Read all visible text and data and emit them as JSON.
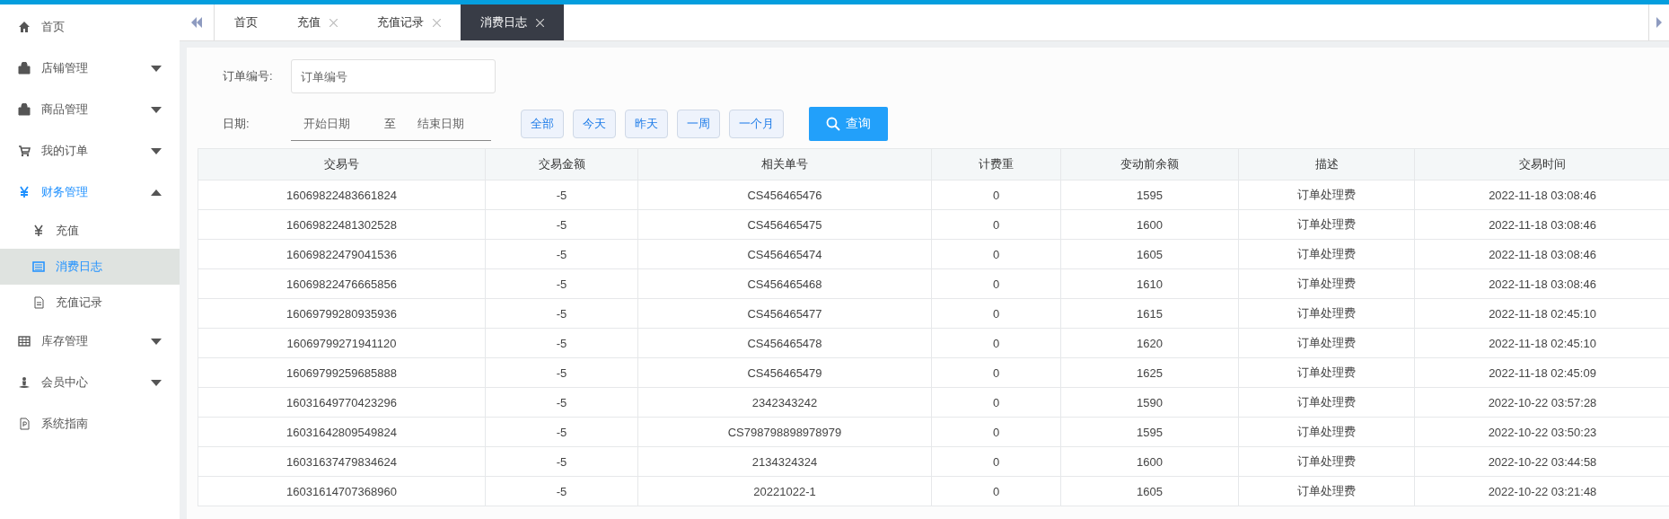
{
  "sidebar": {
    "items": [
      {
        "label": "首页",
        "kind": "link",
        "selected": false
      },
      {
        "label": "店铺管理",
        "kind": "group",
        "selected": false,
        "expanded": false
      },
      {
        "label": "商品管理",
        "kind": "group",
        "selected": false,
        "expanded": false
      },
      {
        "label": "我的订单",
        "kind": "group",
        "selected": false,
        "expanded": false
      },
      {
        "label": "财务管理",
        "kind": "group",
        "selected": true,
        "expanded": true,
        "children": [
          {
            "label": "充值",
            "selected": false
          },
          {
            "label": "消费日志",
            "selected": true
          },
          {
            "label": "充值记录",
            "selected": false
          }
        ]
      },
      {
        "label": "库存管理",
        "kind": "group",
        "selected": false,
        "expanded": false
      },
      {
        "label": "会员中心",
        "kind": "group",
        "selected": false,
        "expanded": false
      },
      {
        "label": "系统指南",
        "kind": "link",
        "selected": false
      }
    ]
  },
  "tabs": [
    {
      "label": "首页",
      "closable": false,
      "selected": false
    },
    {
      "label": "充值",
      "closable": true,
      "selected": false
    },
    {
      "label": "充值记录",
      "closable": true,
      "selected": false
    },
    {
      "label": "消费日志",
      "closable": true,
      "selected": true
    }
  ],
  "filters": {
    "order_label": "订单编号:",
    "order_placeholder": "订单编号",
    "date_label": "日期:",
    "start_placeholder": "开始日期",
    "date_separator": "至",
    "end_placeholder": "结束日期",
    "ranges": [
      "全部",
      "今天",
      "昨天",
      "一周",
      "一个月"
    ],
    "search_button": "查询"
  },
  "table": {
    "columns": [
      "交易号",
      "交易金额",
      "相关单号",
      "计费重",
      "变动前余额",
      "描述",
      "交易时间"
    ],
    "rows": [
      [
        "16069822483661824",
        "-5",
        "CS456465476",
        "0",
        "1595",
        "订单处理费",
        "2022-11-18 03:08:46"
      ],
      [
        "16069822481302528",
        "-5",
        "CS456465475",
        "0",
        "1600",
        "订单处理费",
        "2022-11-18 03:08:46"
      ],
      [
        "16069822479041536",
        "-5",
        "CS456465474",
        "0",
        "1605",
        "订单处理费",
        "2022-11-18 03:08:46"
      ],
      [
        "16069822476665856",
        "-5",
        "CS456465468",
        "0",
        "1610",
        "订单处理费",
        "2022-11-18 03:08:46"
      ],
      [
        "16069799280935936",
        "-5",
        "CS456465477",
        "0",
        "1615",
        "订单处理费",
        "2022-11-18 02:45:10"
      ],
      [
        "16069799271941120",
        "-5",
        "CS456465478",
        "0",
        "1620",
        "订单处理费",
        "2022-11-18 02:45:10"
      ],
      [
        "16069799259685888",
        "-5",
        "CS456465479",
        "0",
        "1625",
        "订单处理费",
        "2022-11-18 02:45:09"
      ],
      [
        "16031649770423296",
        "-5",
        "2342343242",
        "0",
        "1590",
        "订单处理费",
        "2022-10-22 03:57:28"
      ],
      [
        "16031642809549824",
        "-5",
        "CS798798898978979",
        "0",
        "1595",
        "订单处理费",
        "2022-10-22 03:50:23"
      ],
      [
        "16031637479834624",
        "-5",
        "2134324324",
        "0",
        "1600",
        "订单处理费",
        "2022-10-22 03:44:58"
      ],
      [
        "16031614707368960",
        "-5",
        "20221022-1",
        "0",
        "1605",
        "订单处理费",
        "2022-10-22 03:21:48"
      ]
    ]
  }
}
